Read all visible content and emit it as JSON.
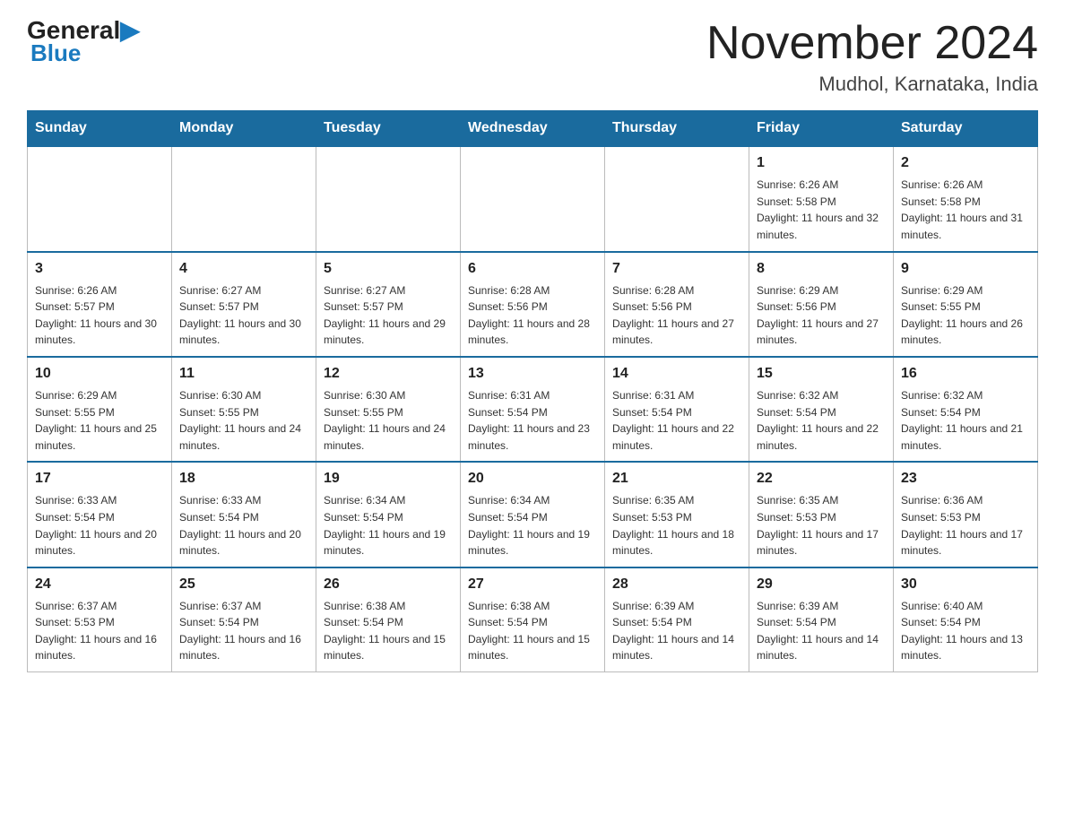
{
  "header": {
    "logo_general": "General",
    "logo_blue": "Blue",
    "month_title": "November 2024",
    "location": "Mudhol, Karnataka, India"
  },
  "weekdays": [
    "Sunday",
    "Monday",
    "Tuesday",
    "Wednesday",
    "Thursday",
    "Friday",
    "Saturday"
  ],
  "weeks": [
    [
      {
        "day": "",
        "sunrise": "",
        "sunset": "",
        "daylight": ""
      },
      {
        "day": "",
        "sunrise": "",
        "sunset": "",
        "daylight": ""
      },
      {
        "day": "",
        "sunrise": "",
        "sunset": "",
        "daylight": ""
      },
      {
        "day": "",
        "sunrise": "",
        "sunset": "",
        "daylight": ""
      },
      {
        "day": "",
        "sunrise": "",
        "sunset": "",
        "daylight": ""
      },
      {
        "day": "1",
        "sunrise": "Sunrise: 6:26 AM",
        "sunset": "Sunset: 5:58 PM",
        "daylight": "Daylight: 11 hours and 32 minutes."
      },
      {
        "day": "2",
        "sunrise": "Sunrise: 6:26 AM",
        "sunset": "Sunset: 5:58 PM",
        "daylight": "Daylight: 11 hours and 31 minutes."
      }
    ],
    [
      {
        "day": "3",
        "sunrise": "Sunrise: 6:26 AM",
        "sunset": "Sunset: 5:57 PM",
        "daylight": "Daylight: 11 hours and 30 minutes."
      },
      {
        "day": "4",
        "sunrise": "Sunrise: 6:27 AM",
        "sunset": "Sunset: 5:57 PM",
        "daylight": "Daylight: 11 hours and 30 minutes."
      },
      {
        "day": "5",
        "sunrise": "Sunrise: 6:27 AM",
        "sunset": "Sunset: 5:57 PM",
        "daylight": "Daylight: 11 hours and 29 minutes."
      },
      {
        "day": "6",
        "sunrise": "Sunrise: 6:28 AM",
        "sunset": "Sunset: 5:56 PM",
        "daylight": "Daylight: 11 hours and 28 minutes."
      },
      {
        "day": "7",
        "sunrise": "Sunrise: 6:28 AM",
        "sunset": "Sunset: 5:56 PM",
        "daylight": "Daylight: 11 hours and 27 minutes."
      },
      {
        "day": "8",
        "sunrise": "Sunrise: 6:29 AM",
        "sunset": "Sunset: 5:56 PM",
        "daylight": "Daylight: 11 hours and 27 minutes."
      },
      {
        "day": "9",
        "sunrise": "Sunrise: 6:29 AM",
        "sunset": "Sunset: 5:55 PM",
        "daylight": "Daylight: 11 hours and 26 minutes."
      }
    ],
    [
      {
        "day": "10",
        "sunrise": "Sunrise: 6:29 AM",
        "sunset": "Sunset: 5:55 PM",
        "daylight": "Daylight: 11 hours and 25 minutes."
      },
      {
        "day": "11",
        "sunrise": "Sunrise: 6:30 AM",
        "sunset": "Sunset: 5:55 PM",
        "daylight": "Daylight: 11 hours and 24 minutes."
      },
      {
        "day": "12",
        "sunrise": "Sunrise: 6:30 AM",
        "sunset": "Sunset: 5:55 PM",
        "daylight": "Daylight: 11 hours and 24 minutes."
      },
      {
        "day": "13",
        "sunrise": "Sunrise: 6:31 AM",
        "sunset": "Sunset: 5:54 PM",
        "daylight": "Daylight: 11 hours and 23 minutes."
      },
      {
        "day": "14",
        "sunrise": "Sunrise: 6:31 AM",
        "sunset": "Sunset: 5:54 PM",
        "daylight": "Daylight: 11 hours and 22 minutes."
      },
      {
        "day": "15",
        "sunrise": "Sunrise: 6:32 AM",
        "sunset": "Sunset: 5:54 PM",
        "daylight": "Daylight: 11 hours and 22 minutes."
      },
      {
        "day": "16",
        "sunrise": "Sunrise: 6:32 AM",
        "sunset": "Sunset: 5:54 PM",
        "daylight": "Daylight: 11 hours and 21 minutes."
      }
    ],
    [
      {
        "day": "17",
        "sunrise": "Sunrise: 6:33 AM",
        "sunset": "Sunset: 5:54 PM",
        "daylight": "Daylight: 11 hours and 20 minutes."
      },
      {
        "day": "18",
        "sunrise": "Sunrise: 6:33 AM",
        "sunset": "Sunset: 5:54 PM",
        "daylight": "Daylight: 11 hours and 20 minutes."
      },
      {
        "day": "19",
        "sunrise": "Sunrise: 6:34 AM",
        "sunset": "Sunset: 5:54 PM",
        "daylight": "Daylight: 11 hours and 19 minutes."
      },
      {
        "day": "20",
        "sunrise": "Sunrise: 6:34 AM",
        "sunset": "Sunset: 5:54 PM",
        "daylight": "Daylight: 11 hours and 19 minutes."
      },
      {
        "day": "21",
        "sunrise": "Sunrise: 6:35 AM",
        "sunset": "Sunset: 5:53 PM",
        "daylight": "Daylight: 11 hours and 18 minutes."
      },
      {
        "day": "22",
        "sunrise": "Sunrise: 6:35 AM",
        "sunset": "Sunset: 5:53 PM",
        "daylight": "Daylight: 11 hours and 17 minutes."
      },
      {
        "day": "23",
        "sunrise": "Sunrise: 6:36 AM",
        "sunset": "Sunset: 5:53 PM",
        "daylight": "Daylight: 11 hours and 17 minutes."
      }
    ],
    [
      {
        "day": "24",
        "sunrise": "Sunrise: 6:37 AM",
        "sunset": "Sunset: 5:53 PM",
        "daylight": "Daylight: 11 hours and 16 minutes."
      },
      {
        "day": "25",
        "sunrise": "Sunrise: 6:37 AM",
        "sunset": "Sunset: 5:54 PM",
        "daylight": "Daylight: 11 hours and 16 minutes."
      },
      {
        "day": "26",
        "sunrise": "Sunrise: 6:38 AM",
        "sunset": "Sunset: 5:54 PM",
        "daylight": "Daylight: 11 hours and 15 minutes."
      },
      {
        "day": "27",
        "sunrise": "Sunrise: 6:38 AM",
        "sunset": "Sunset: 5:54 PM",
        "daylight": "Daylight: 11 hours and 15 minutes."
      },
      {
        "day": "28",
        "sunrise": "Sunrise: 6:39 AM",
        "sunset": "Sunset: 5:54 PM",
        "daylight": "Daylight: 11 hours and 14 minutes."
      },
      {
        "day": "29",
        "sunrise": "Sunrise: 6:39 AM",
        "sunset": "Sunset: 5:54 PM",
        "daylight": "Daylight: 11 hours and 14 minutes."
      },
      {
        "day": "30",
        "sunrise": "Sunrise: 6:40 AM",
        "sunset": "Sunset: 5:54 PM",
        "daylight": "Daylight: 11 hours and 13 minutes."
      }
    ]
  ]
}
